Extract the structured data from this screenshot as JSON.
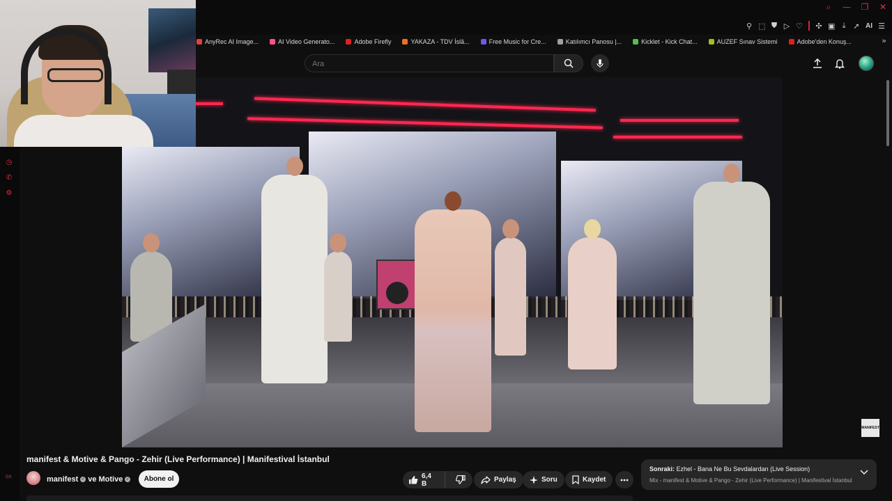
{
  "browser": {
    "bookmarks": [
      {
        "label": "AnyRec AI Image...",
        "color": "#e04040"
      },
      {
        "label": "AI Video Generato...",
        "color": "#ff5090"
      },
      {
        "label": "Adobe Firefly",
        "color": "#e02020"
      },
      {
        "label": "YAKAZA - TDV İslā...",
        "color": "#f07020"
      },
      {
        "label": "Free Music for Cre...",
        "color": "#6a5af0"
      },
      {
        "label": "Katılımcı Panosu |...",
        "color": "#a0a0a0"
      },
      {
        "label": "Kicklet - Kick Chat...",
        "color": "#50c050"
      },
      {
        "label": "AUZEF Sınav Sistemi",
        "color": "#a0c020"
      },
      {
        "label": "Adobe'den Konuş...",
        "color": "#e02020"
      }
    ],
    "toolbar_ai_label": "AI"
  },
  "youtube": {
    "search": {
      "placeholder": "Ara",
      "value": ""
    },
    "video": {
      "title": "manifest & Motive & Pango - Zehir (Live Performance) | Manifestival İstanbul",
      "channel_a": "manifest",
      "channel_joiner": "ve",
      "channel_b": "Motive",
      "subscribe_label": "Abone ol",
      "likes": "6,4 B",
      "share_label": "Paylaş",
      "ask_label": "Soru",
      "save_label": "Kaydet",
      "watermark": "MANIFEST"
    },
    "next": {
      "prefix": "Sonraki:",
      "title": "Ezhel - Bana Ne Bu Sevdalardan (Live Session)",
      "subtitle": "Mix - manifest & Motive & Pango - Zehir (Live Performance) | Manifestival İstanbul"
    }
  },
  "sidebar": {
    "bottom_label": "GX"
  },
  "colors": {
    "accent": "#e0304a",
    "background": "#0f0f0f",
    "pill": "#272727"
  }
}
